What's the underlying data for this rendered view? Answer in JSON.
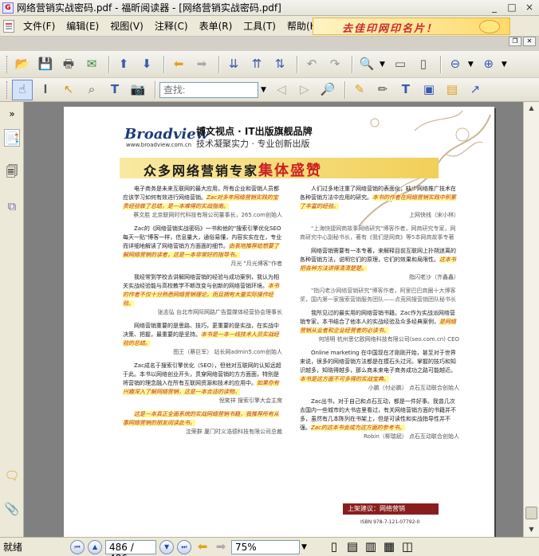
{
  "window": {
    "title": "网络营销实战密码.pdf - 福昕阅读器 - [网络营销实战密码.pdf]",
    "minimize": "_",
    "maximize": "□",
    "close": "×"
  },
  "menu": {
    "items": [
      "文件(F)",
      "编辑(E)",
      "视图(V)",
      "注释(C)",
      "表单(R)",
      "工具(T)",
      "帮助(H)"
    ]
  },
  "ad": {
    "text": "去佳印网印名片！"
  },
  "toolbar": {
    "search_placeholder": "查找:"
  },
  "status": {
    "ready": "就绪",
    "page": "486 / 486",
    "zoom": "75%"
  },
  "doc": {
    "brand": "Broadview",
    "brand_url": "www.broadview.com.cn",
    "slogan1": "博文视点 · IT出版旗舰品牌",
    "slogan2": "技术凝聚实力 · 专业创新出版",
    "banner_plain": "众多网络营销专家",
    "banner_emph": "集体盛赞",
    "left": [
      {
        "text": "电子商务是未来互联网的最大应用，所有企业和营销人员都应该学习如何有效进行网络营销。",
        "hl": "Zac对多年网络营销实践的宝贵经验做了总结，是一本难得的实战指南。",
        "by": "蔡文胜 北京联网时代科技有限公司董事长，265.com创始人"
      },
      {
        "text": "Zac的《网络营销实战密码》一书和他的\"搜索引擎优化SEO每天一贴\"博客一样，信息量大，通俗易懂，内容实实在在，专业而详细地解读了网络营销方方面面的细节。",
        "hl": "由衷地推荐给想要了解网络营销的读者，这是一本非常好的指导书。",
        "by": "月光 \"月光博客\"作者"
      },
      {
        "text": "我经常到学校去讲解网络营销的经验与成功案例，我认为相关实战经验能与高校教学不断改变与创新的网络营销环境。",
        "hl": "本书的作者不仅十分熟悉网络营销理论，而且拥有大量实际操作经验。",
        "by": "张志弘 台北市网际网路广告暨媒体经营协会理事长"
      },
      {
        "text": "网络营销重要的是思路、技巧，更重要的是实战，在实战中决策、把握，最重要的是坚持。",
        "hl": "本书是一本一线技术人员实战经验的总结。",
        "by": "图王（蔡巨军） 站长网admin5.com创始人"
      },
      {
        "text": "Zac成名于搜索引擎优化（SEO），但他对互联网的认知远超于此。本书以网络创业开头，贯穿网络营销的方方面面，特别是将营销的理念融入在所有互联网资源和技术的应用中。",
        "hl": "如果你有兴趣深入了解网络营销，这是一本合适的读物。",
        "by": "倪笑祥 搜索引擎大会主席"
      },
      {
        "text": "",
        "hl": "这是一本真正全面系统的实战网络营销书籍，我推荐所有从事网络营销的朋友阅读此书。",
        "by": "沈荣群 厦门时义浩德科技有限公司总裁"
      }
    ],
    "right": [
      {
        "text": "人们过多地注重了网络营销的表面化，缺少网络推广技术在各种营销方法中应用的研究。",
        "hl": "本书的作者在网络营销实践中积累了丰富的经验。",
        "by": "上网快线（宋小林）"
      },
      {
        "text": "\"上海快捷网商故事网络研究\"博客作者，网商研究专家，网商研究中心副秘书长，著有《我们是网商》等5本网商故事专著",
        "hl": "",
        "by": ""
      },
      {
        "text": "网络营销需要有一本专著，来解释目前互联网上扑朔迷离的各种营销方法，说明它们的原理，它们的效果和局限性。",
        "hl": "这本书把各种方法讲得清清楚楚。",
        "by": "指闪老沙（齐鑫鑫）"
      },
      {
        "text": "\"指闪老沙网络营销研究\"博客作者，阿里巴巴商圈十大博客奖，国内第一家搜索营销服务团队——点竞网搜营销团队秘书长",
        "hl": "",
        "by": ""
      },
      {
        "text": "我所见过的最实用的网络营销书籍。Zac作为实战派网络营销专家，本书结合了他本人的实战经验及众多经典案例，",
        "hl": "是网络营销从业者和企业经营者的必读书。",
        "by": "何旭明 杭州思亿欧网络科技有限公司(seo.com.cn) CEO"
      },
      {
        "text": "Online marketing 在中国现在才刚刚开始，甚至对于世界来说，很多的网络营销方法都是在摸石头过河。掌握的技巧和知识越多，知晓得越多，那么商未来电子商务成功之路可能越近。",
        "hl": "本书是这方面不可多得的实战宝典。",
        "by": "小鹏（付必鹏） 点石互动联合创始人"
      },
      {
        "text": "Zac出书，对于自己和点石互动，都是一件好事。我曾几次去国内一些城市的大书店里看过，有关网络营销方面的书籍并不多，虽然有几本陈列在书架上，但是可读性和实战指导性并不强。",
        "hl": "Zac的这本书会成为这方面的参考书。",
        "by": "Robin（柳瑞斌） 点石互动联合创始人"
      }
    ],
    "bottom_label": "上架建议：网络营销",
    "isbn": "ISBN 978-7-121-07792-0"
  }
}
